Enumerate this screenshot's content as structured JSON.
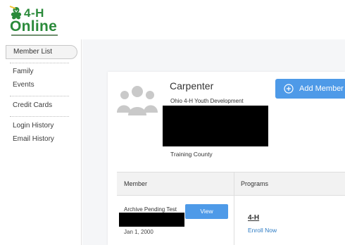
{
  "logo": {
    "brand_4h": "4-H",
    "brand_online": "Online",
    "brand_color": "#2a8a3a"
  },
  "sidebar": {
    "items": [
      {
        "label": "Member List",
        "active": true
      },
      {
        "label": "Family"
      },
      {
        "label": "Events"
      },
      {
        "label": "Credit Cards"
      },
      {
        "label": "Login History"
      },
      {
        "label": "Email History"
      }
    ]
  },
  "family": {
    "name": "Carpenter",
    "club": "Ohio 4-H Youth Development",
    "county": "Training County",
    "icon": "people-icon"
  },
  "actions": {
    "add_member_label": "Add Member",
    "add_member_icon": "plus-circle-icon",
    "accent_color": "#4e9ae8"
  },
  "members_table": {
    "headers": [
      "Member",
      "Programs"
    ],
    "rows": [
      {
        "name": "Archive Pending Test",
        "view_label": "View",
        "dob": "Jan 1, 2000",
        "program": "4-H",
        "enroll_label": "Enroll Now"
      }
    ]
  }
}
